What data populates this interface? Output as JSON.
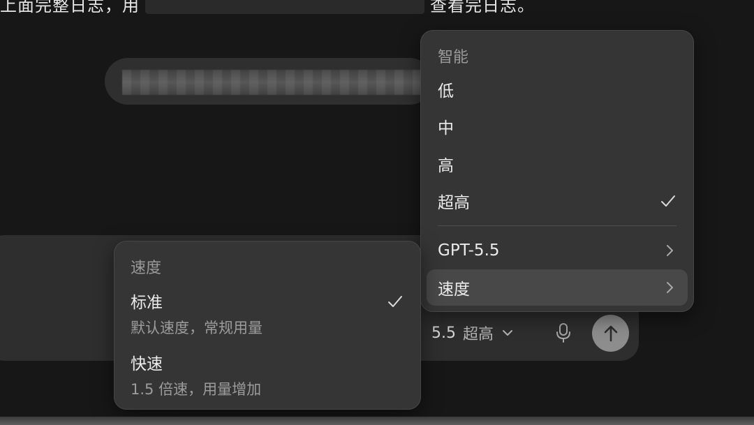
{
  "conversation": {
    "top_line_left": "上面完整日志，用",
    "top_line_right": "查看完日志。"
  },
  "composer": {
    "model": "5.5",
    "effort": "超高"
  },
  "effort_menu": {
    "header": "智能",
    "items": [
      {
        "label": "低"
      },
      {
        "label": "中"
      },
      {
        "label": "高"
      },
      {
        "label": "超高",
        "selected": true
      }
    ],
    "submenus": [
      {
        "label": "GPT-5.5"
      },
      {
        "label": "速度",
        "highlighted": true
      }
    ]
  },
  "speed_menu": {
    "header": "速度",
    "items": [
      {
        "title": "标准",
        "desc": "默认速度，常规用量",
        "selected": true
      },
      {
        "title": "快速",
        "desc": "1.5 倍速，用量增加"
      }
    ]
  },
  "colors": {
    "background": "#171717",
    "menu": "#353535",
    "send_button": "#8d8d8d"
  }
}
